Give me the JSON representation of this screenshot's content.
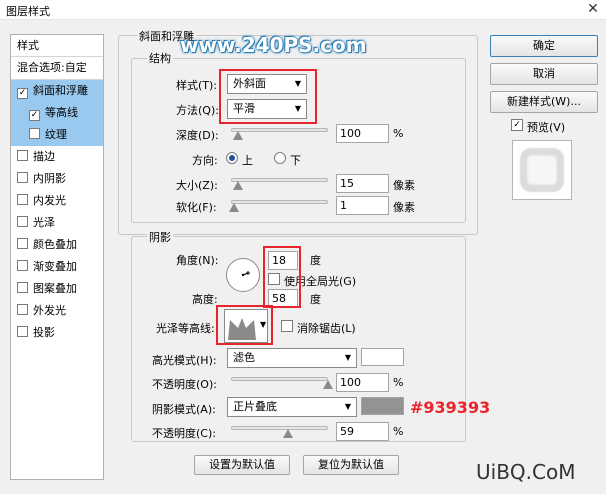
{
  "window": {
    "title": "图层样式",
    "close_glyph": "✕"
  },
  "watermark": "www.240PS.com",
  "sidebar": {
    "header": "样式",
    "blend_options": "混合选项:自定",
    "items": [
      {
        "label": "斜面和浮雕",
        "checked": true,
        "selected": true
      },
      {
        "label": "等高线",
        "checked": true,
        "selected": true,
        "indent": true
      },
      {
        "label": "纹理",
        "checked": false,
        "selected": true,
        "indent": true
      },
      {
        "label": "描边",
        "checked": false
      },
      {
        "label": "内阴影",
        "checked": false
      },
      {
        "label": "内发光",
        "checked": false
      },
      {
        "label": "光泽",
        "checked": false
      },
      {
        "label": "颜色叠加",
        "checked": false
      },
      {
        "label": "渐变叠加",
        "checked": false
      },
      {
        "label": "图案叠加",
        "checked": false
      },
      {
        "label": "外发光",
        "checked": false
      },
      {
        "label": "投影",
        "checked": false
      }
    ]
  },
  "bevel": {
    "group_title": "斜面和浮雕",
    "structure_title": "结构",
    "style_label": "样式(T):",
    "style_value": "外斜面",
    "technique_label": "方法(Q):",
    "technique_value": "平滑",
    "depth_label": "深度(D):",
    "depth_value": "100",
    "depth_unit": "%",
    "direction_label": "方向:",
    "direction_up": "上",
    "direction_down": "下",
    "size_label": "大小(Z):",
    "size_value": "15",
    "size_unit": "像素",
    "soften_label": "软化(F):",
    "soften_value": "1",
    "soften_unit": "像素"
  },
  "shading": {
    "title": "阴影",
    "angle_label": "角度(N):",
    "angle_value": "18",
    "angle_unit": "度",
    "global_light_label": "使用全局光(G)",
    "altitude_label": "高度:",
    "altitude_value": "58",
    "altitude_unit": "度",
    "gloss_label": "光泽等高线:",
    "antialias_label": "消除锯齿(L)",
    "highlight_mode_label": "高光模式(H):",
    "highlight_mode_value": "滤色",
    "highlight_color": "#ffffff",
    "highlight_opacity_label": "不透明度(O):",
    "highlight_opacity_value": "100",
    "highlight_opacity_unit": "%",
    "shadow_mode_label": "阴影模式(A):",
    "shadow_mode_value": "正片叠底",
    "shadow_color": "#939393",
    "shadow_color_label": "#939393",
    "shadow_opacity_label": "不透明度(C):",
    "shadow_opacity_value": "59",
    "shadow_opacity_unit": "%"
  },
  "buttons": {
    "ok": "确定",
    "cancel": "取消",
    "new_style": "新建样式(W)...",
    "preview": "预览(V)",
    "make_default": "设置为默认值",
    "reset_default": "复位为默认值"
  },
  "slider_levels": {
    "depth": 0.07,
    "size": 0.07,
    "soften": 0.03,
    "highlight_opacity": 1.0,
    "shadow_opacity": 0.59
  }
}
